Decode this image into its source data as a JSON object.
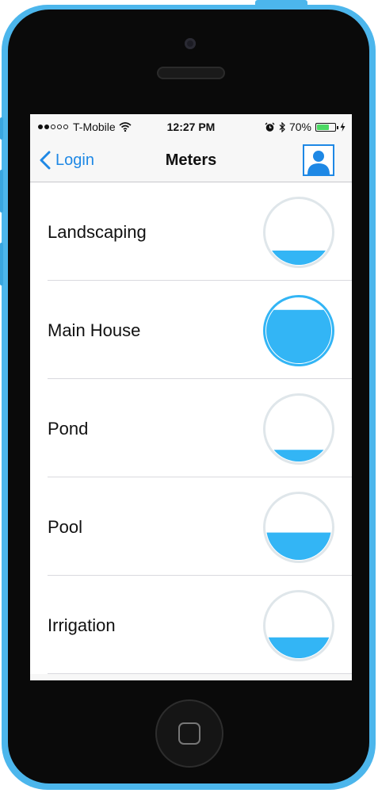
{
  "status_bar": {
    "carrier": "T-Mobile",
    "time": "12:27 PM",
    "battery": "70%",
    "battery_level": 0.7,
    "icons": [
      "signal-dots-icon",
      "wifi-icon",
      "alarm-icon",
      "bluetooth-icon",
      "battery-icon",
      "charging-icon"
    ]
  },
  "nav": {
    "back_label": "Login",
    "title": "Meters",
    "profile_icon": "person-icon"
  },
  "colors": {
    "accent": "#1e88e5",
    "water": "#33b5f5",
    "gauge_ring": "#dfe6ea",
    "phone_shell": "#4cb6ec"
  },
  "meters": [
    {
      "label": "Landscaping",
      "level": 0.22
    },
    {
      "label": "Main House",
      "level": 0.82
    },
    {
      "label": "Pond",
      "level": 0.18
    },
    {
      "label": "Pool",
      "level": 0.42
    },
    {
      "label": "Irrigation",
      "level": 0.32
    }
  ]
}
